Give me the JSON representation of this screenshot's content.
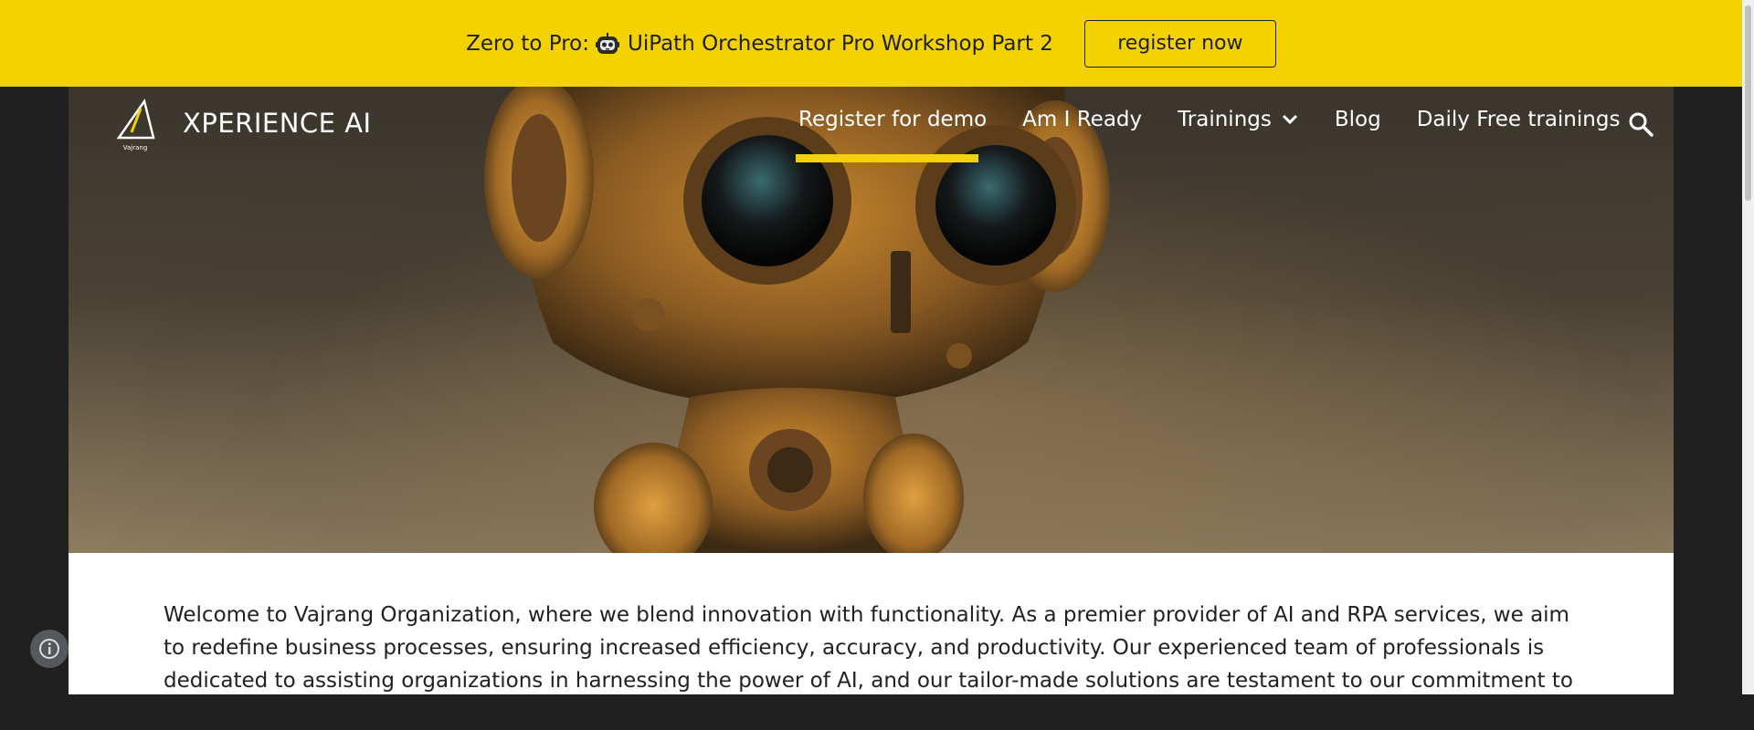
{
  "banner": {
    "text_before": "Zero to Pro:",
    "emoji_icon": "robot-face-icon",
    "text_after": "UiPath Orchestrator Pro Workshop Part 2",
    "button_label": "register now",
    "background": "#f4d200"
  },
  "header": {
    "site_title": "XPERIENCE AI",
    "logo_caption": "Vajrang",
    "nav": [
      {
        "label": "Register for demo",
        "active": true
      },
      {
        "label": "Am I Ready"
      },
      {
        "label": "Trainings",
        "has_dropdown": true
      },
      {
        "label": "Blog"
      },
      {
        "label": "Daily Free trainings"
      }
    ],
    "accent": "#f4d200",
    "search_icon": "search-icon"
  },
  "hero": {
    "image": "robot-illustration"
  },
  "main": {
    "intro": "Welcome to Vajrang Organization, where we blend innovation with functionality. As a premier provider of AI and RPA services, we aim to redefine business processes, ensuring increased efficiency, accuracy, and productivity. Our experienced team of professionals is dedicated to assisting organizations in harnessing the power of AI, and our tailor-made solutions are testament to our commitment to excellence."
  },
  "footer": {
    "info_icon": "info-icon"
  }
}
